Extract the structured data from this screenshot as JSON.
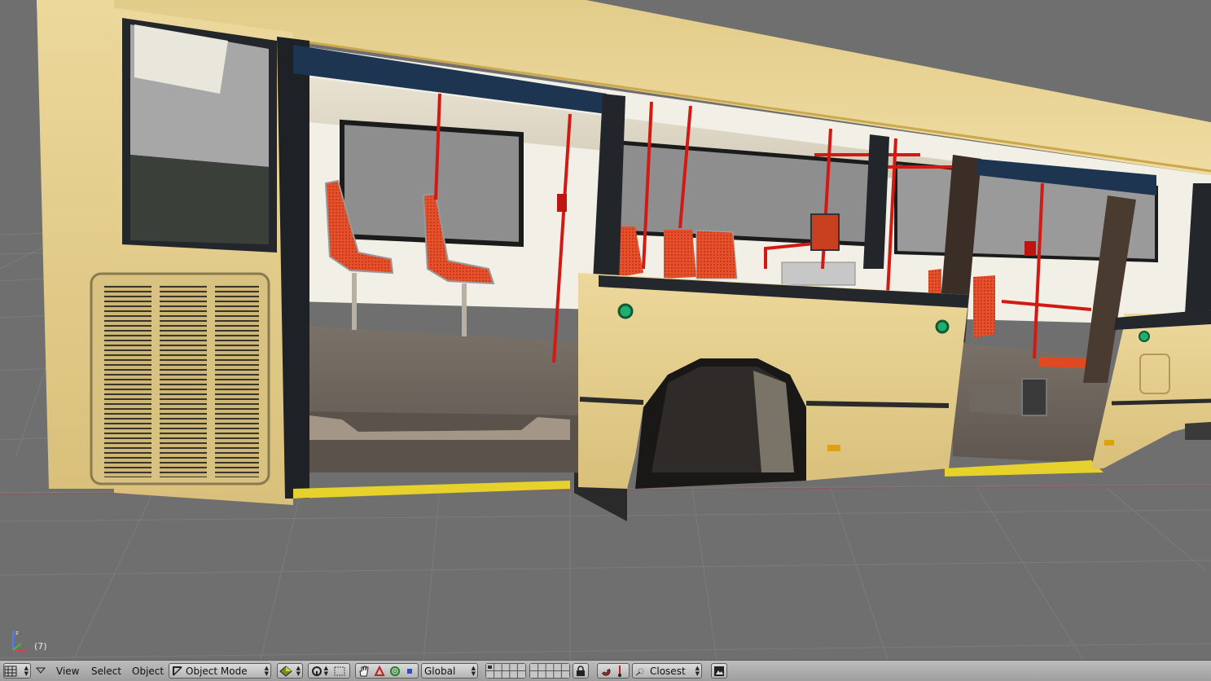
{
  "viewport": {
    "frame_indicator": "(7)",
    "object": "bus-body"
  },
  "header": {
    "editor_type_icon": "grid-icon",
    "collapse_icon": "triangle-down-icon",
    "menus": [
      "View",
      "Select",
      "Object"
    ],
    "mode": {
      "label": "Object Mode",
      "icon": "object-mode-icon"
    },
    "draw_type_icon": "shading-sphere-icon",
    "pivot_icon": "pivot-icon",
    "manipulator_icons": [
      "hand-icon",
      "translate-icon",
      "rotate-icon",
      "scale-icon"
    ],
    "orientation": "Global",
    "layer_lock_icon": "lock-icon",
    "snap_icon": "magnet-icon",
    "snap_element_icon": "snap-element-icon",
    "snap_target": "Closest",
    "render_icon": "render-icon"
  },
  "colors": {
    "bus_body": "#e5cf8f",
    "window_frame": "#1f2328",
    "seat_red": "#e04a22",
    "pole_red": "#d21a14",
    "floor": "#6a625a",
    "grid_bg": "#6f6f6f",
    "header_bg": "#a8a8a8"
  }
}
